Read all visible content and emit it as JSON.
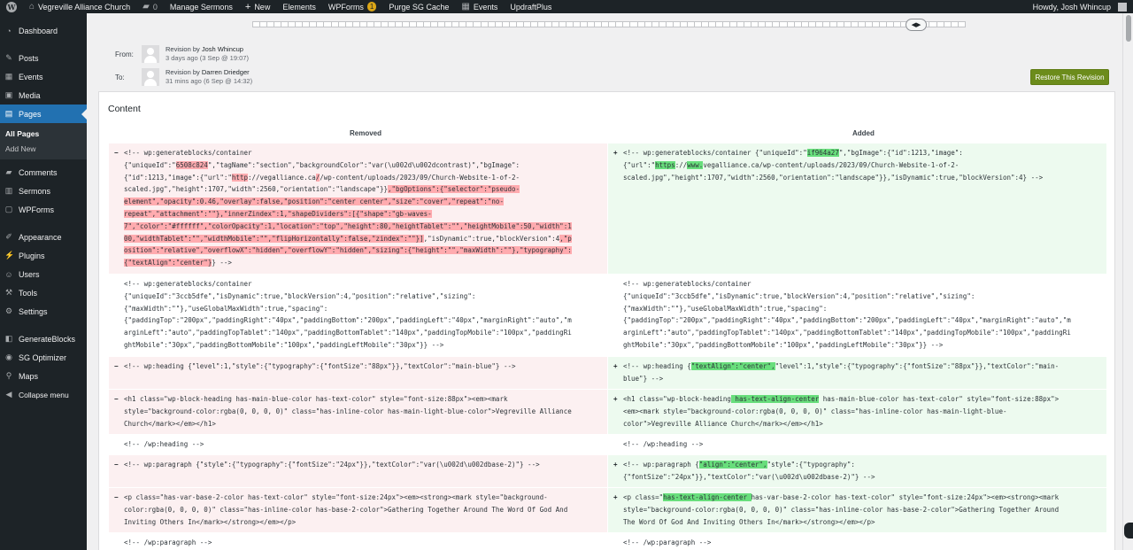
{
  "adminbar": {
    "site": "Vegreville Alliance Church",
    "comments_count": "0",
    "manage_sermons": "Manage Sermons",
    "new": "New",
    "elements": "Elements",
    "wpforms": "WPForms",
    "wpforms_badge": "1",
    "purge": "Purge SG Cache",
    "events": "Events",
    "updraft": "UpdraftPlus",
    "howdy": "Howdy, Josh Whincup"
  },
  "sidebar": {
    "dashboard": "Dashboard",
    "posts": "Posts",
    "events": "Events",
    "media": "Media",
    "pages": "Pages",
    "all_pages": "All Pages",
    "add_new": "Add New",
    "comments": "Comments",
    "sermons": "Sermons",
    "wpforms": "WPForms",
    "appearance": "Appearance",
    "plugins": "Plugins",
    "users": "Users",
    "tools": "Tools",
    "settings": "Settings",
    "generateblocks": "GenerateBlocks",
    "sg_optimizer": "SG Optimizer",
    "maps": "Maps",
    "collapse": "Collapse menu"
  },
  "revision": {
    "from_label": "From:",
    "to_label": "To:",
    "from_by": "Revision by",
    "from_author": "Josh Whincup",
    "from_when": "3 days ago",
    "from_date": "(3 Sep @ 19:07)",
    "to_by": "Revision by",
    "to_author": "Darren Driedger",
    "to_when": "31 mins ago",
    "to_date": "(6 Sep @ 14:32)",
    "restore_label": "Restore This Revision"
  },
  "content": {
    "heading": "Content",
    "removed": "Removed",
    "added": "Added"
  },
  "diff": {
    "r1_left_a": "<!-- wp:generateblocks/container\n{\"uniqueId\":\"",
    "r1_left_h1": "6508c824",
    "r1_left_b": "\",\"tagName\":\"section\",\"backgroundColor\":\"var(\\u002d\\u002dcontrast)\",\"bgImage\":\n{\"id\":1213,\"image\":{\"url\":\"",
    "r1_left_h2": "http",
    "r1_left_c": "://vegalliance.ca",
    "r1_left_h3": "/",
    "r1_left_d": "/wp-content/uploads/2023/09/Church-Website-1-of-2-\nscaled.jpg\",\"height\":1707,\"width\":2560,\"orientation\":\"landscape\"}}",
    "r1_left_h4": ",\"bgOptions\":{\"selector\":\"pseudo-\nelement\",\"opacity\":0.46,\"overlay\":false,\"position\":\"center center\",\"size\":\"cover\",\"repeat\":\"no-\nrepeat\",\"attachment\":\"\"},\"innerZindex\":1,\"shapeDividers\":[{\"shape\":\"gb-waves-\n7\",\"color\":\"#ffffff\",\"colorOpacity\":1,\"location\":\"top\",\"height\":80,\"heightTablet\":\"\",\"heightMobile\":50,\"width\":1\n00,\"widthTablet\":\"\",\"widthMobile\":\"\",\"flipHorizontally\":false,\"zindex\":\"\"}]",
    "r1_left_e": ",\"isDynamic\":true,\"blockVersion\":4",
    "r1_left_h5": ",\"p\nosition\":\"relative\",\"overflowX\":\"hidden\",\"overflowY\":\"hidden\",\"sizing\":{\"height\":\"\",\"maxWidth\":\"\"},\"typography\":\n{\"textAlign\":\"center\"}",
    "r1_left_f": "} -->",
    "r1_right_a": "<!-- wp:generateblocks/container {\"uniqueId\":\"",
    "r1_right_h1": "if964a27",
    "r1_right_b": "\",\"bgImage\":{\"id\":1213,\"image\":\n{\"url\":\"",
    "r1_right_h2": "https",
    "r1_right_c": "://",
    "r1_right_h3": "www.",
    "r1_right_d": "vegalliance.ca/wp-content/uploads/2023/09/Church-Website-1-of-2-\nscaled.jpg\",\"height\":1707,\"width\":2560,\"orientation\":\"landscape\"}},\"isDynamic\":true,\"blockVersion\":4} -->",
    "r2_both": "<!-- wp:generateblocks/container\n{\"uniqueId\":\"3ccb5dfe\",\"isDynamic\":true,\"blockVersion\":4,\"position\":\"relative\",\"sizing\":\n{\"maxWidth\":\"\"},\"useGlobalMaxWidth\":true,\"spacing\":\n{\"paddingTop\":\"200px\",\"paddingRight\":\"40px\",\"paddingBottom\":\"200px\",\"paddingLeft\":\"40px\",\"marginRight\":\"auto\",\"m\narginLeft\":\"auto\",\"paddingTopTablet\":\"140px\",\"paddingBottomTablet\":\"140px\",\"paddingTopMobile\":\"100px\",\"paddingRi\nghtMobile\":\"30px\",\"paddingBottomMobile\":\"100px\",\"paddingLeftMobile\":\"30px\"}} -->",
    "r3_left": "<!-- wp:heading {\"level\":1,\"style\":{\"typography\":{\"fontSize\":\"88px\"}},\"textColor\":\"main-blue\"} -->",
    "r3_right_a": "<!-- wp:heading {",
    "r3_right_h": "\"textAlign\":\"center\",",
    "r3_right_b": "\"level\":1,\"style\":{\"typography\":{\"fontSize\":\"88px\"}},\"textColor\":\"main-\nblue\"} -->",
    "r4_left": "<h1 class=\"wp-block-heading has-main-blue-color has-text-color\" style=\"font-size:88px\"><em><mark\nstyle=\"background-color:rgba(0, 0, 0, 0)\" class=\"has-inline-color has-main-light-blue-color\">Vegreville Alliance\nChurch</mark></em></h1>",
    "r4_right_a": "<h1 class=\"wp-block-heading",
    "r4_right_h": " has-text-align-center",
    "r4_right_b": " has-main-blue-color has-text-color\" style=\"font-size:88px\">\n<em><mark style=\"background-color:rgba(0, 0, 0, 0)\" class=\"has-inline-color has-main-light-blue-\ncolor\">Vegreville Alliance Church</mark></em></h1>",
    "r5_both": "<!-- /wp:heading -->",
    "r6_left": "<!-- wp:paragraph {\"style\":{\"typography\":{\"fontSize\":\"24px\"}},\"textColor\":\"var(\\u002d\\u002dbase-2)\"} -->",
    "r6_right_a": "<!-- wp:paragraph {",
    "r6_right_h": "\"align\":\"center\",",
    "r6_right_b": "\"style\":{\"typography\":\n{\"fontSize\":\"24px\"}},\"textColor\":\"var(\\u002d\\u002dbase-2)\"} -->",
    "r7_left": "<p class=\"has-var-base-2-color has-text-color\" style=\"font-size:24px\"><em><strong><mark style=\"background-\ncolor:rgba(0, 0, 0, 0)\" class=\"has-inline-color has-base-2-color\">Gathering Together Around The Word Of God And\nInviting Others In</mark></strong></em></p>",
    "r7_right_a": "<p class=\"",
    "r7_right_h": "has-text-align-center ",
    "r7_right_b": "has-var-base-2-color has-text-color\" style=\"font-size:24px\"><em><strong><mark\nstyle=\"background-color:rgba(0, 0, 0, 0)\" class=\"has-inline-color has-base-2-color\">Gathering Together Around\nThe Word Of God And Inviting Others In</mark></strong></em></p>",
    "r8_both": "<!-- /wp:paragraph -->",
    "minus": "−",
    "plus": "+"
  },
  "colors": {
    "sidebar_bg": "#1d2327",
    "accent": "#2271b1",
    "restore_button": "#6c8c1b",
    "removed_bg": "#fcf0f1",
    "removed_highlight": "#ffabaf",
    "added_bg": "#edfaef",
    "added_highlight": "#68de7c"
  }
}
